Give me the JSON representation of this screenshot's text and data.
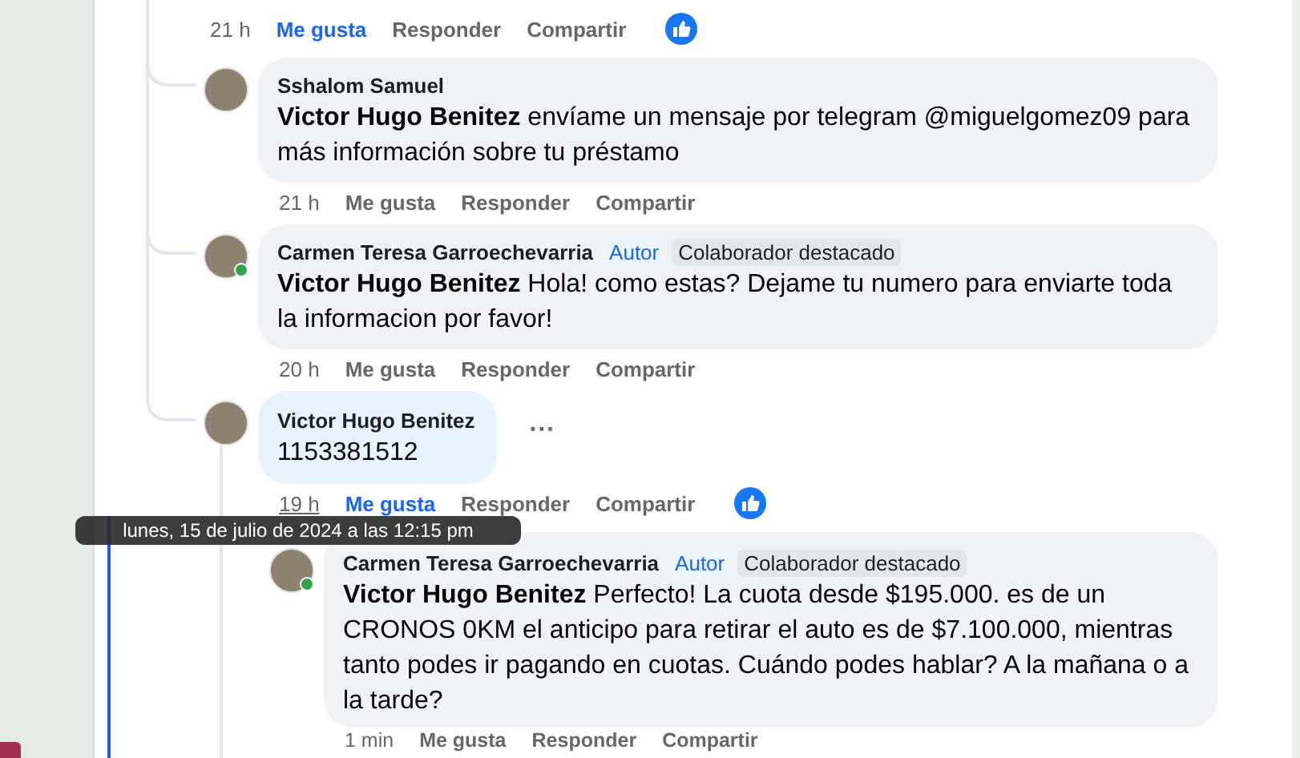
{
  "top_actions": {
    "time": "21 h",
    "like": "Me gusta",
    "reply": "Responder",
    "share": "Compartir",
    "liked": true,
    "reacted": true,
    "time_hovered": false
  },
  "comments": [
    {
      "name": "Sshalom Samuel",
      "mention": "Victor Hugo Benitez",
      "text": "envíame un mensaje por telegram @miguelgomez09 para más información sobre tu préstamo",
      "online": false,
      "highlighted": false,
      "actions": {
        "time": "21 h",
        "like": "Me gusta",
        "reply": "Responder",
        "share": "Compartir",
        "liked": false,
        "reacted": false,
        "time_hovered": false
      }
    },
    {
      "name": "Carmen Teresa Garroechevarria",
      "badges": [
        {
          "label": "Autor",
          "kind": "author"
        },
        {
          "label": "Colaborador destacado",
          "kind": "top"
        }
      ],
      "mention": "Victor Hugo Benitez",
      "text": "Hola! como estas? Dejame tu numero para enviarte toda la informacion por favor!",
      "online": true,
      "highlighted": false,
      "actions": {
        "time": "20 h",
        "like": "Me gusta",
        "reply": "Responder",
        "share": "Compartir",
        "liked": false,
        "reacted": false,
        "time_hovered": false
      }
    },
    {
      "name": "Victor Hugo Benitez",
      "text": "1153381512",
      "online": false,
      "highlighted": true,
      "more": "···",
      "actions": {
        "time": "19 h",
        "like": "Me gusta",
        "reply": "Responder",
        "share": "Compartir",
        "liked": true,
        "reacted": true,
        "time_hovered": true
      },
      "replies": [
        {
          "name": "Carmen Teresa Garroechevarria",
          "badges": [
            {
              "label": "Autor",
              "kind": "author"
            },
            {
              "label": "Colaborador destacado",
              "kind": "top"
            }
          ],
          "mention": "Victor Hugo Benitez",
          "text": "Perfecto! La cuota desde $195.000. es de un CRONOS 0KM el anticipo para retirar el auto es de $7.100.000, mientras tanto podes ir pagando en cuotas. Cuándo podes hablar? A la mañana o a la tarde?",
          "online": true,
          "highlighted": false,
          "actions": {
            "time": "1 min",
            "like": "Me gusta",
            "reply": "Responder",
            "share": "Compartir",
            "liked": false,
            "reacted": false,
            "time_hovered": false
          }
        }
      ]
    }
  ],
  "tooltip": "lunes, 15 de julio de 2024 a las 12:15 pm"
}
